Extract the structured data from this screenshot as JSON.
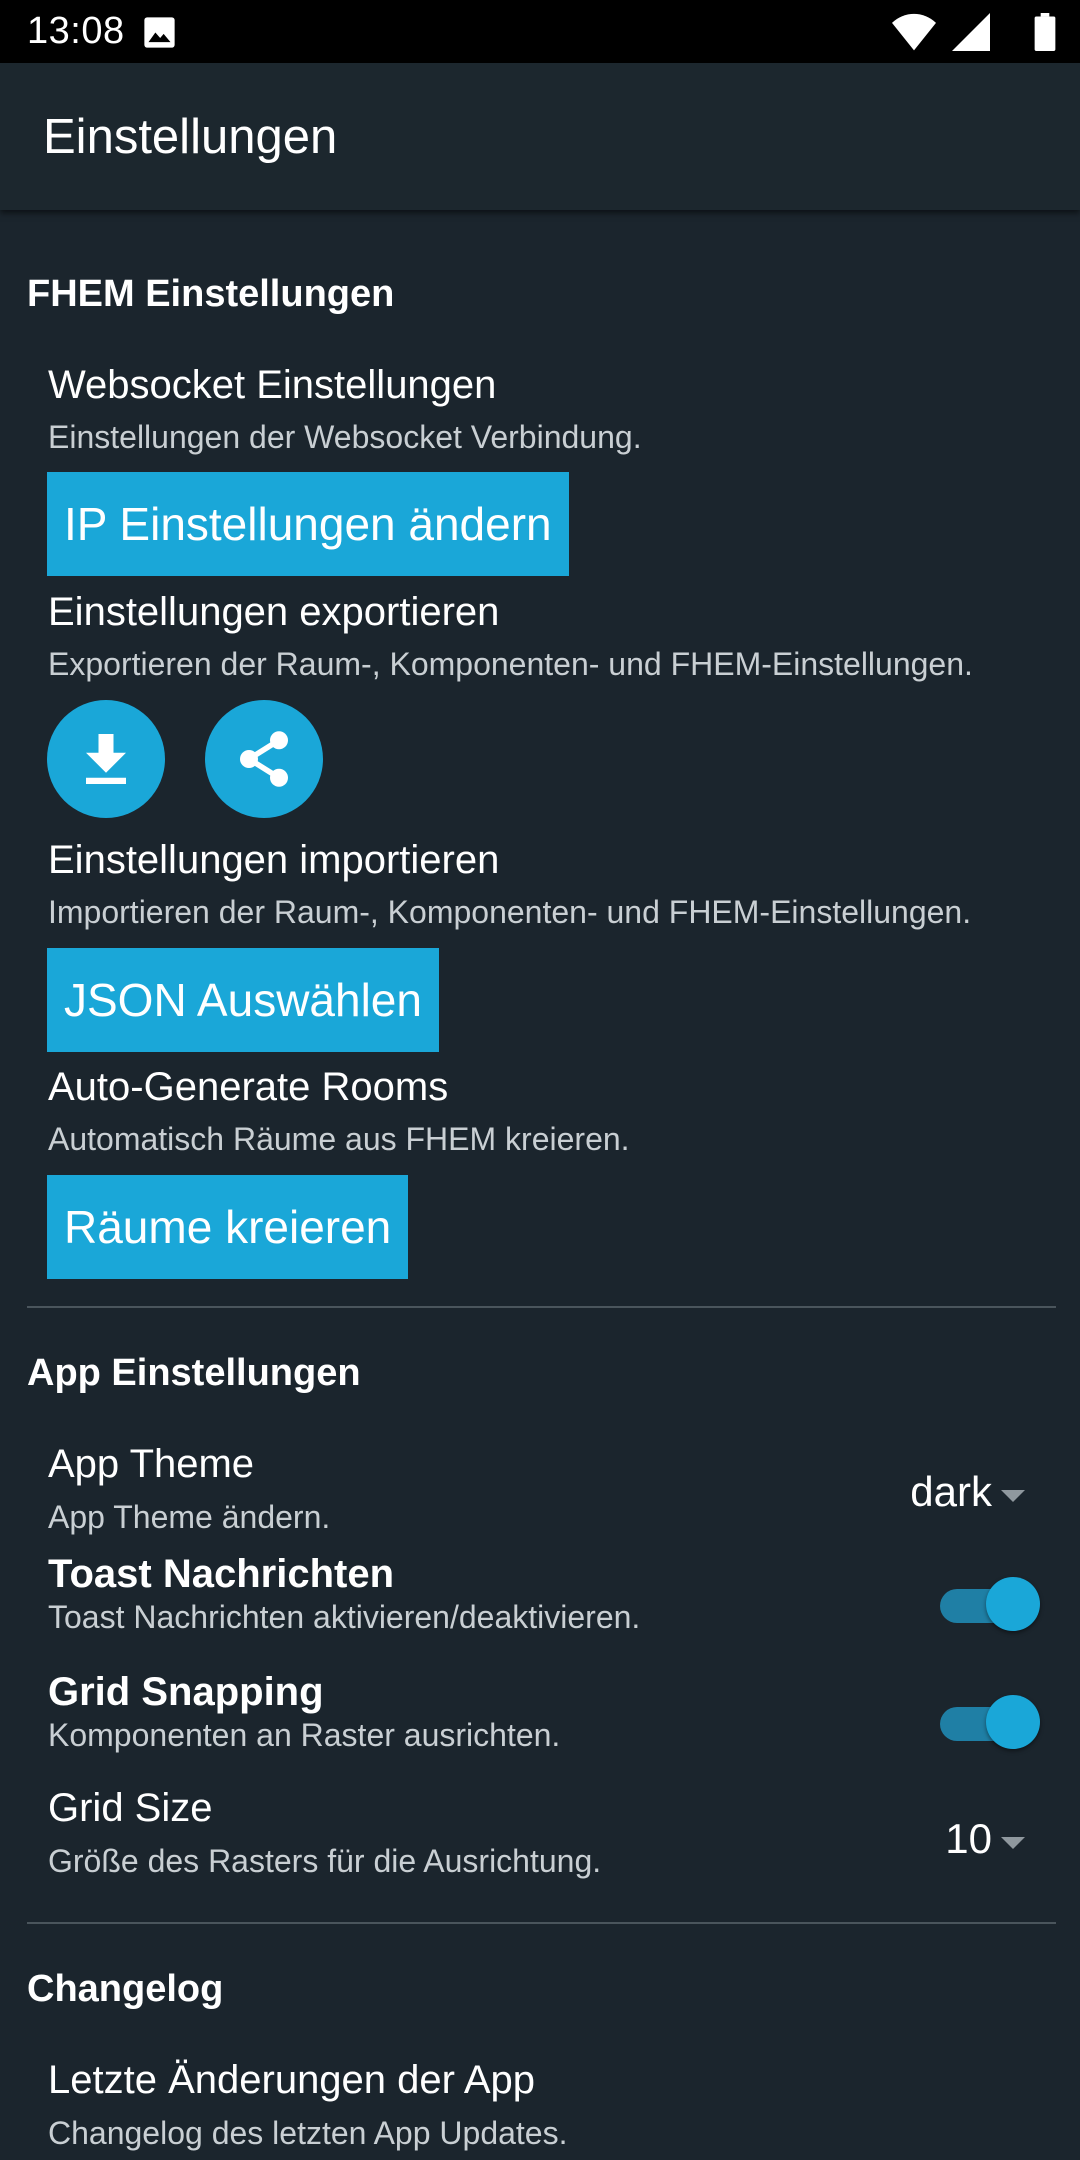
{
  "status_bar": {
    "time": "13:08",
    "icons": [
      "image-icon",
      "wifi-icon",
      "signal-icon",
      "battery-icon"
    ]
  },
  "app_bar": {
    "title": "Einstellungen"
  },
  "fhem": {
    "section_title": "FHEM Einstellungen",
    "websocket": {
      "title": "Websocket Einstellungen",
      "subtitle": "Einstellungen der Websocket Verbindung.",
      "button": "IP Einstellungen ändern"
    },
    "export": {
      "title": "Einstellungen exportieren",
      "subtitle": "Exportieren der Raum-, Komponenten- und FHEM-Einstellungen.",
      "icons": [
        "download-icon",
        "share-icon"
      ]
    },
    "import": {
      "title": "Einstellungen importieren",
      "subtitle": "Importieren der Raum-, Komponenten- und FHEM-Einstellungen.",
      "button": "JSON Auswählen"
    },
    "auto_rooms": {
      "title": "Auto-Generate Rooms",
      "subtitle": "Automatisch Räume aus FHEM kreieren.",
      "button": "Räume kreieren"
    }
  },
  "app": {
    "section_title": "App Einstellungen",
    "theme": {
      "title": "App Theme",
      "subtitle": "App Theme ändern.",
      "value": "dark"
    },
    "toast": {
      "title": "Toast Nachrichten",
      "subtitle": "Toast Nachrichten aktivieren/deaktivieren.",
      "enabled": true
    },
    "grid_snapping": {
      "title": "Grid Snapping",
      "subtitle": "Komponenten an Raster ausrichten.",
      "enabled": true
    },
    "grid_size": {
      "title": "Grid Size",
      "subtitle": "Größe des Rasters für die Ausrichtung.",
      "value": "10"
    }
  },
  "changelog": {
    "section_title": "Changelog",
    "latest": {
      "title": "Letzte Änderungen der App",
      "subtitle": "Changelog des letzten App Updates."
    }
  },
  "colors": {
    "background": "#1b252d",
    "app_bar": "#1c272e",
    "accent": "#1aa7d8",
    "subtitle_text": "#c9cfd3",
    "divider": "#4a555c"
  }
}
